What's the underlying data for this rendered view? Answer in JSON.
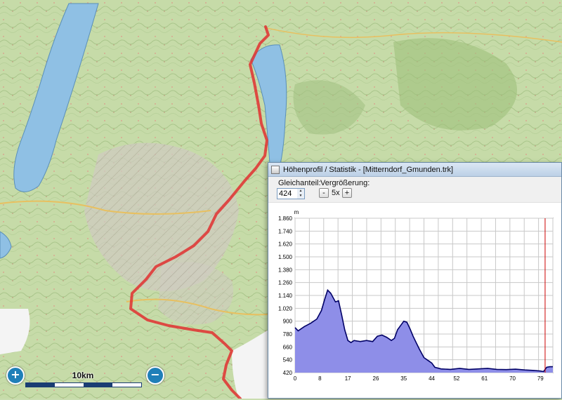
{
  "map": {
    "scale_label": "10km",
    "zoom_in_icon": "zoom-in-icon",
    "zoom_out_icon": "zoom-out-icon"
  },
  "profile_window": {
    "title": "Höhenprofil / Statistik - [Mitterndorf_Gmunden.trk]",
    "gleichanteil_label": "Gleichanteil:",
    "gleichanteil_value": "424",
    "vergroesserung_label": "Vergrößerung:",
    "minus_label": "-",
    "zoom_factor": "5x",
    "plus_label": "+"
  },
  "colors": {
    "route": "#e03030",
    "lake": "#8fc0e4",
    "profile_fill": "#8e8ee8",
    "profile_line": "#000066",
    "cursor_line": "#cc0000"
  },
  "chart_data": {
    "type": "area",
    "ylabel": "m",
    "yticks": [
      "1.860",
      "1.740",
      "1.620",
      "1.500",
      "1.380",
      "1.260",
      "1.140",
      "1.020",
      "900",
      "780",
      "660",
      "540",
      "420"
    ],
    "xticks": [
      "0",
      "8",
      "17",
      "26",
      "35",
      "44",
      "52",
      "61",
      "70",
      "79"
    ],
    "ylim": [
      420,
      1860
    ],
    "xlim": [
      0,
      83
    ],
    "grid": true,
    "cursor_x": 80.5,
    "x": [
      0,
      1,
      3,
      5,
      7,
      8.5,
      9.5,
      10.5,
      11.5,
      13,
      14,
      15,
      16,
      17,
      18,
      19,
      21,
      23,
      25,
      26.5,
      28,
      29.5,
      31,
      32,
      33,
      34,
      35,
      36,
      37,
      38,
      39,
      40,
      41.5,
      43,
      44,
      45,
      47,
      50,
      53,
      56,
      59,
      62,
      65,
      68,
      71,
      74,
      77,
      79,
      80,
      81,
      82,
      83
    ],
    "y": [
      840,
      810,
      850,
      880,
      920,
      1000,
      1100,
      1190,
      1160,
      1080,
      1090,
      960,
      820,
      720,
      700,
      720,
      710,
      720,
      710,
      760,
      770,
      750,
      720,
      740,
      820,
      860,
      900,
      890,
      830,
      760,
      700,
      640,
      560,
      530,
      510,
      470,
      455,
      450,
      460,
      450,
      455,
      460,
      450,
      448,
      452,
      445,
      440,
      435,
      430,
      470,
      475,
      475
    ]
  }
}
